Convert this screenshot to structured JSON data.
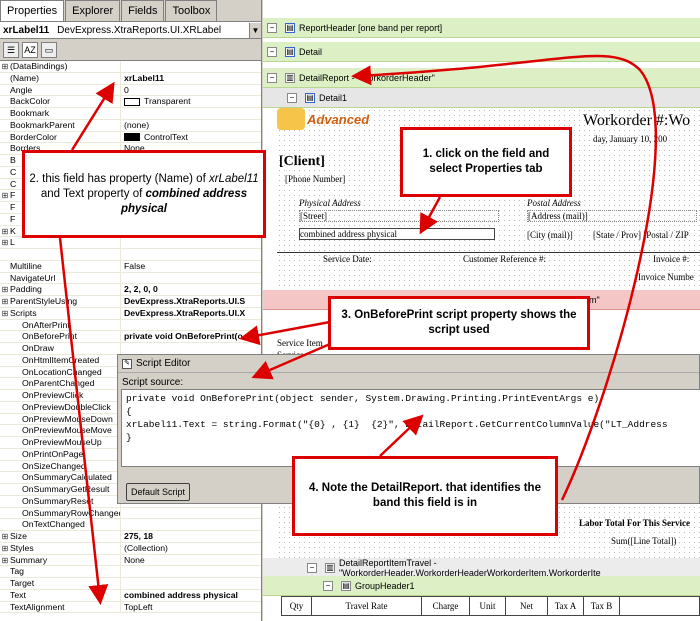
{
  "tabs": [
    "Properties",
    "Explorer",
    "Fields",
    "Toolbox"
  ],
  "object_selector": {
    "name": "xrLabel11",
    "type": "DevExpress.XtraReports.UI.XRLabel"
  },
  "props": [
    {
      "name": "(DataBindings)",
      "value": "",
      "exp": "+"
    },
    {
      "name": "(Name)",
      "value": "xrLabel11",
      "bold": true
    },
    {
      "name": "Angle",
      "value": "0"
    },
    {
      "name": "BackColor",
      "value": "Transparent",
      "swatch": "#ffffff"
    },
    {
      "name": "Bookmark",
      "value": ""
    },
    {
      "name": "BookmarkParent",
      "value": "(none)"
    },
    {
      "name": "BorderColor",
      "value": "ControlText",
      "swatch": "#000000"
    },
    {
      "name": "Borders",
      "value": "None"
    },
    {
      "name": "B",
      "value": ""
    },
    {
      "name": "C",
      "value": ""
    },
    {
      "name": "C",
      "value": ""
    },
    {
      "name": "F",
      "value": "",
      "exp": "+"
    },
    {
      "name": "F",
      "value": ""
    },
    {
      "name": "F",
      "value": ""
    },
    {
      "name": "K",
      "value": "",
      "exp": "+"
    },
    {
      "name": "L",
      "value": "",
      "exp": "+"
    },
    {
      "name": "",
      "value": ""
    },
    {
      "name": "Multiline",
      "value": "False"
    },
    {
      "name": "NavigateUrl",
      "value": ""
    },
    {
      "name": "Padding",
      "value": "2, 2, 0, 0",
      "bold": true,
      "exp": "+"
    },
    {
      "name": "ParentStyleUsing",
      "value": "DevExpress.XtraReports.UI.S",
      "bold": true,
      "exp": "+"
    },
    {
      "name": "Scripts",
      "value": "DevExpress.XtraReports.UI.X",
      "bold": true,
      "exp": "-"
    },
    {
      "name": "OnAfterPrint",
      "value": "",
      "sub": true
    },
    {
      "name": "OnBeforePrint",
      "value": "private void OnBeforePrint(o",
      "sub": true,
      "bold": true
    },
    {
      "name": "OnDraw",
      "value": "",
      "sub": true
    },
    {
      "name": "OnHtmlItemCreated",
      "value": "",
      "sub": true
    },
    {
      "name": "OnLocationChanged",
      "value": "",
      "sub": true
    },
    {
      "name": "OnParentChanged",
      "value": "",
      "sub": true
    },
    {
      "name": "OnPreviewClick",
      "value": "",
      "sub": true
    },
    {
      "name": "OnPreviewDoubleClick",
      "value": "",
      "sub": true
    },
    {
      "name": "OnPreviewMouseDown",
      "value": "",
      "sub": true
    },
    {
      "name": "OnPreviewMouseMove",
      "value": "",
      "sub": true
    },
    {
      "name": "OnPreviewMouseUp",
      "value": "",
      "sub": true
    },
    {
      "name": "OnPrintOnPage",
      "value": "",
      "sub": true
    },
    {
      "name": "OnSizeChanged",
      "value": "",
      "sub": true
    },
    {
      "name": "OnSummaryCalculated",
      "value": "",
      "sub": true
    },
    {
      "name": "OnSummaryGetResult",
      "value": "",
      "sub": true
    },
    {
      "name": "OnSummaryReset",
      "value": "",
      "sub": true
    },
    {
      "name": "OnSummaryRowChanged",
      "value": "",
      "sub": true
    },
    {
      "name": "OnTextChanged",
      "value": "",
      "sub": true
    },
    {
      "name": "Size",
      "value": "275, 18",
      "bold": true,
      "exp": "+"
    },
    {
      "name": "Styles",
      "value": "(Collection)",
      "exp": "+"
    },
    {
      "name": "Summary",
      "value": "None",
      "exp": "+"
    },
    {
      "name": "Tag",
      "value": ""
    },
    {
      "name": "Target",
      "value": ""
    },
    {
      "name": "Text",
      "value": "combined address physical",
      "bold": true
    },
    {
      "name": "TextAlignment",
      "value": "TopLeft"
    }
  ],
  "bands": {
    "report_header": "ReportHeader [one band per report]",
    "detail": "Detail",
    "detail_report": "DetailReport - \"WorkorderHeader\"",
    "detail1": "Detail1",
    "detail_report_travel": "DetailReportItemTravel - \"WorkorderHeader.WorkorderHeaderWorkorderItem.WorkorderIte",
    "group_header": "GroupHeader1",
    "mid_band_tail": "m\""
  },
  "report": {
    "logo": "Advanced",
    "title": "Workorder #:Wo",
    "date": "day, January 10, 200",
    "client": "[Client]",
    "phone": "[Phone Number]",
    "phys_addr": "Physical Address",
    "street": "[Street]",
    "combined": "combined address physical",
    "postal_addr": "Postal Address",
    "address_mail": "[Address (mail)]",
    "city_mail": "[City (mail)]",
    "state_postal": "[State / Prov] [Postal / ZIP",
    "service_date": "Service Date:",
    "cust_ref": "Customer Reference #:",
    "invoice": "Invoice #:",
    "invoice_number": "[Invoice Numbe",
    "service_item": "Service Item",
    "service": "Service",
    "labor_total": "Labor Total For This Service",
    "sum_line": "Sum([Line Total])",
    "cols": [
      "Qty",
      "Travel Rate",
      "Charge",
      "Unit",
      "Net",
      "Tax A",
      "Tax B"
    ]
  },
  "dialog": {
    "title": "Script Editor",
    "source_label": "Script source:",
    "code": [
      "private void OnBeforePrint(object sender, System.Drawing.Printing.PrintEventArgs e)",
      "{",
      "xrLabel11.Text = string.Format(\"{0} , {1}  {2}\", DetailReport.GetCurrentColumnValue(\"LT_Address",
      "}"
    ],
    "default_btn": "Default Script"
  },
  "notes": {
    "n1": "1. click on the field and select Properties tab",
    "n2_a": "2. this field has property (Name) of ",
    "n2_b": "xrLabel11",
    "n2_c": " and Text property of ",
    "n2_d": "combined address physical",
    "n3": "3. OnBeforePrint script property shows the script used",
    "n4": "4. Note the DetailReport. that identifies the band this field is in"
  },
  "colors": {
    "annotation": "#dd0000",
    "band_green": "#dcefc5",
    "selection": "#316ac5"
  }
}
